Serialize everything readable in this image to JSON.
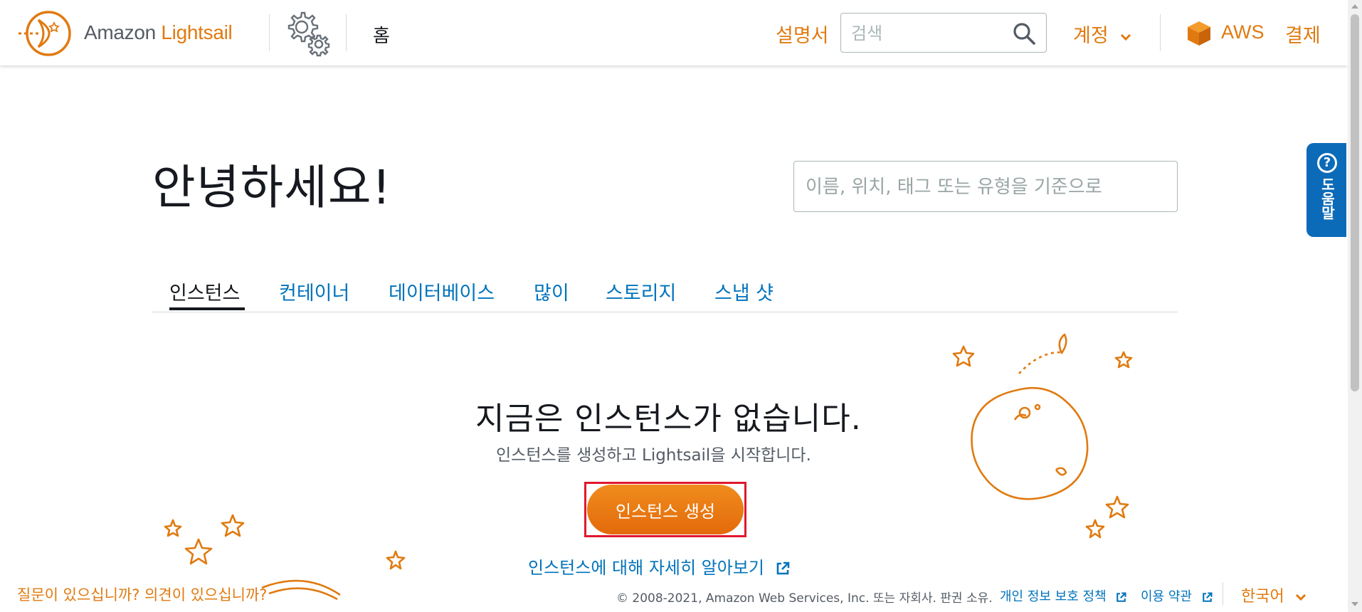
{
  "header": {
    "brand_prefix": "Amazon ",
    "brand_accent": "Lightsail",
    "home_label": "홈",
    "docs_label": "설명서",
    "search_placeholder": "검색",
    "account_label": "계정",
    "aws_label": "AWS",
    "billing_label": "결제"
  },
  "help_tab": {
    "icon": "?",
    "label": "도움말"
  },
  "main": {
    "greeting": "안녕하세요!",
    "filter_placeholder": "이름, 위치, 태그 또는 유형을 기준으로",
    "tabs": [
      {
        "label": "인스턴스",
        "active": true
      },
      {
        "label": "컨테이너"
      },
      {
        "label": "데이터베이스"
      },
      {
        "label": "많이"
      },
      {
        "label": "스토리지"
      },
      {
        "label": "스냅 샷"
      }
    ],
    "empty_title": "지금은 인스턴스가 없습니다.",
    "empty_subtitle": "인스턴스를 생성하고 Lightsail을 시작합니다.",
    "create_button": "인스턴스 생성",
    "learn_more": "인스턴스에 대해 자세히 알아보기"
  },
  "footer": {
    "feedback": "질문이 있으십니까? 의견이 있으십니까?",
    "copyright": "© 2008-2021, Amazon Web Services, Inc. 또는 자회사. 판권 소유.",
    "privacy": "개인 정보 보호 정책",
    "terms": "이용 약관",
    "language": "한국어"
  },
  "colors": {
    "brand_orange": "#e07a10",
    "link_blue": "#0073bb",
    "help_blue": "#0b6bb8",
    "highlight_red": "#e0182d"
  },
  "icons": {
    "logo": "lightsail-logo-icon",
    "gear": "gear-icon",
    "search": "search-icon",
    "account_chevron": "chevron-down-icon",
    "aws_cube": "aws-cube-icon",
    "external": "external-link-icon"
  }
}
